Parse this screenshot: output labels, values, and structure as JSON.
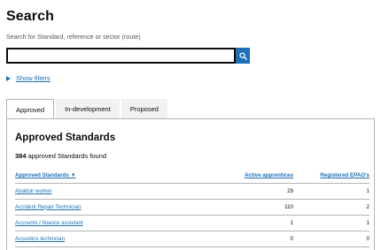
{
  "page": {
    "title": "Search",
    "hint": "Search for Standard, reference or sector (route)",
    "search_value": "",
    "show_filters": "Show filters"
  },
  "tabs": [
    {
      "label": "Approved",
      "active": true
    },
    {
      "label": "In-development",
      "active": false
    },
    {
      "label": "Proposed",
      "active": false
    }
  ],
  "panel": {
    "title": "Approved Standards",
    "count": "384",
    "count_suffix": " approved Standards found"
  },
  "table": {
    "headers": [
      "Approved Standards ▼",
      "Active apprentices",
      "Registered EPAO's"
    ],
    "rows": [
      {
        "name": "Abattoir worker",
        "active": "29",
        "epao": "1"
      },
      {
        "name": "Accident Repair Technician",
        "active": "110",
        "epao": "2"
      },
      {
        "name": "Accounts / finance assistant",
        "active": "1",
        "epao": "1"
      },
      {
        "name": "Acoustics technician",
        "active": "0",
        "epao": "0"
      }
    ]
  },
  "colors": {
    "accent": "#1d70b8",
    "text": "#0b0c0c",
    "muted": "#505a5f",
    "border": "#b1b4b6"
  },
  "icons": {
    "search_button": "search-icon",
    "filters_toggle": "triangle-right-icon"
  }
}
